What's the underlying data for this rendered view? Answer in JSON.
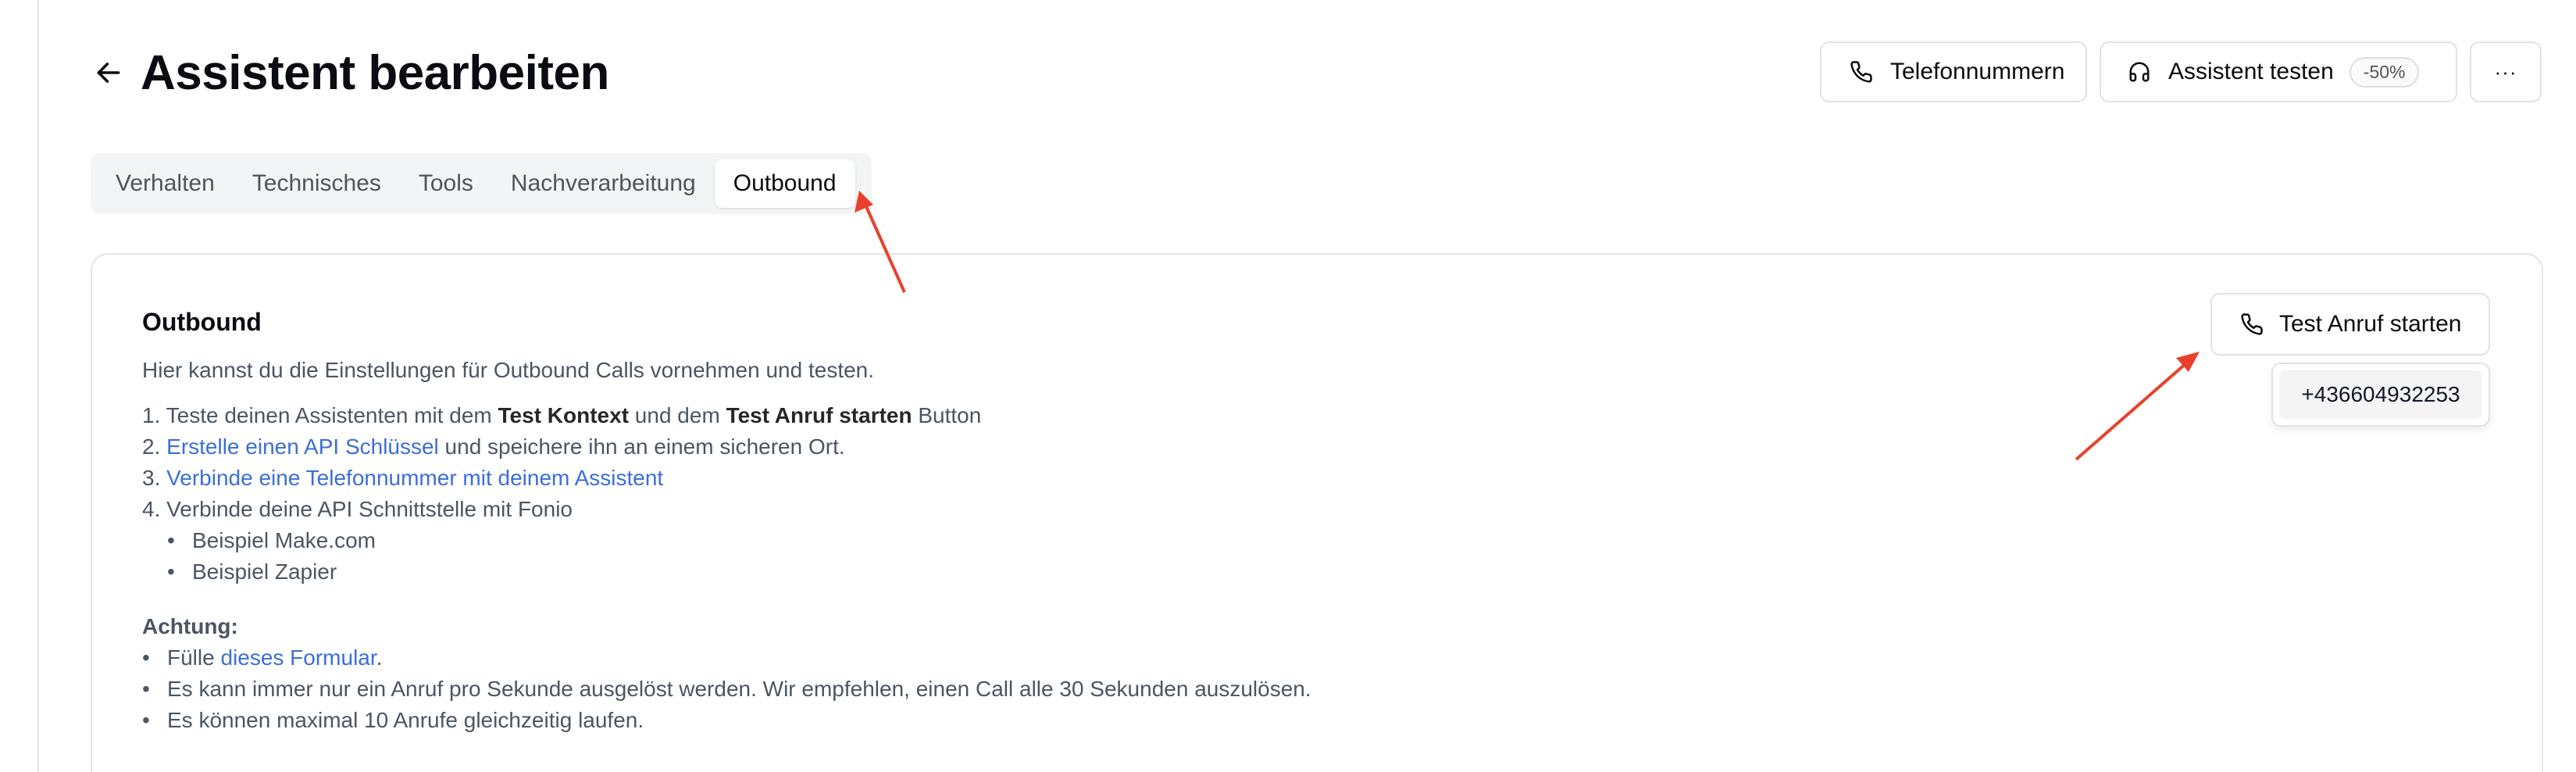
{
  "header": {
    "title": "Assistent bearbeiten",
    "phones_button": "Telefonnummern",
    "test_button": "Assistent testen",
    "test_badge": "-50%",
    "more_button": "···"
  },
  "tabs": [
    "Verhalten",
    "Technisches",
    "Tools",
    "Nachverarbeitung",
    "Outbound"
  ],
  "active_tab": "Outbound",
  "card": {
    "title": "Outbound",
    "description": "Hier kannst du die Einstellungen für Outbound Calls vornehmen und testen.",
    "step1_prefix": "1. Teste deinen Assistenten mit dem ",
    "step1_bold1": "Test Kontext",
    "step1_mid": " und dem ",
    "step1_bold2": "Test Anruf starten",
    "step1_suffix": " Button",
    "step2_prefix": "2. ",
    "step2_link": "Erstelle einen API Schlüssel",
    "step2_suffix": " und speichere ihn an einem sicheren Ort.",
    "step3_prefix": "3. ",
    "step3_link": "Verbinde eine Telefonnummer mit deinem Assistent",
    "step4": "4. Verbinde deine API Schnittstelle mit Fonio",
    "example1": "Beispiel Make.com",
    "example2": "Beispiel Zapier",
    "warning_title": "Achtung:",
    "warn1_prefix": "Fülle ",
    "warn1_link": "dieses Formular",
    "warn1_suffix": ".",
    "warn2": "Es kann immer nur ein Anruf pro Sekunde ausgelöst werden. Wir empfehlen, einen Call alle 30 Sekunden auszulösen.",
    "warn3": "Es können maximal 10 Anrufe gleichzeitig laufen.",
    "call_button": "Test Anruf starten",
    "phone_number": "+436604932253"
  },
  "colors": {
    "link": "#3b6fd6",
    "annotation_arrow": "#e8412b"
  }
}
